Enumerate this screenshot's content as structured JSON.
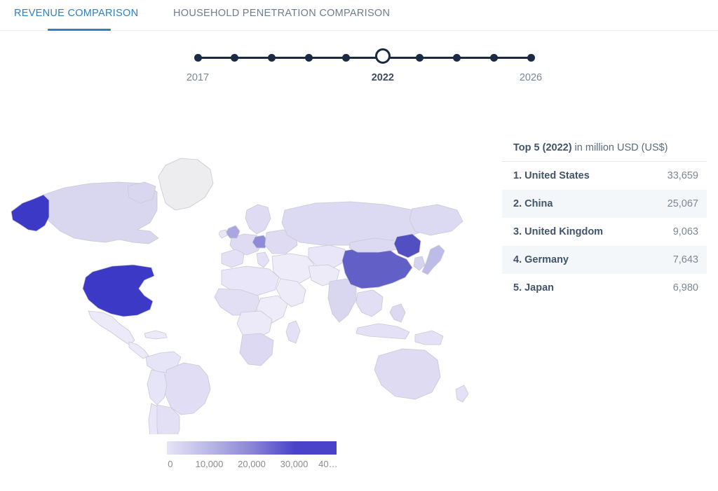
{
  "tabs": [
    {
      "label": "REVENUE COMPARISON",
      "active": true
    },
    {
      "label": "HOUSEHOLD PENETRATION COMPARISON",
      "active": false
    }
  ],
  "colors": {
    "tab_active": "#2f80c4",
    "tab_inactive": "#6e7d8e",
    "slider": "#1b2a44",
    "scale_min": "#f2f1fb",
    "scale_max": "#3333cc"
  },
  "slider": {
    "years": [
      "2017",
      "2018",
      "2019",
      "2020",
      "2021",
      "2022",
      "2023",
      "2024",
      "2025",
      "2026"
    ],
    "selected_year": "2022",
    "selected_index": 5,
    "visible_labels": [
      {
        "text": "2017",
        "index": 0,
        "selected": false
      },
      {
        "text": "2022",
        "index": 5,
        "selected": true
      },
      {
        "text": "2026",
        "index": 9,
        "selected": false
      }
    ]
  },
  "top5": {
    "title_strong": "Top 5 (2022)",
    "title_rest": " in million USD (US$)",
    "rows": [
      {
        "name": "1. United States",
        "value": "33,659"
      },
      {
        "name": "2. China",
        "value": "25,067"
      },
      {
        "name": "3. United Kingdom",
        "value": "9,063"
      },
      {
        "name": "4. Germany",
        "value": "7,643"
      },
      {
        "name": "5. Japan",
        "value": "6,980"
      }
    ]
  },
  "legend": {
    "segments": [
      "#e6e4f7",
      "#b9b6e6",
      "#8a86d6",
      "#4a43c9"
    ],
    "labels": [
      {
        "text": "0",
        "pos": 2
      },
      {
        "text": "10,000",
        "pos": 25
      },
      {
        "text": "20,000",
        "pos": 50
      },
      {
        "text": "30,000",
        "pos": 75
      },
      {
        "text": "40…",
        "pos": 95
      }
    ]
  },
  "chart_data": {
    "type": "heatmap",
    "title": "Revenue Comparison",
    "subtitle": "Top 5 (2022) in million USD (US$)",
    "unit": "million USD (US$)",
    "year": "2022",
    "colorbar": {
      "ticks": [
        0,
        10000,
        20000,
        30000,
        40000
      ],
      "tick_labels": [
        "0",
        "10,000",
        "20,000",
        "30,000",
        "40…"
      ],
      "range": [
        0,
        40000
      ],
      "colors": [
        "#e6e4f7",
        "#b9b6e6",
        "#8a86d6",
        "#4a43c9"
      ]
    },
    "regions": [
      {
        "name": "United States",
        "value": 33659,
        "rank": 1,
        "fill": "#3b39c6"
      },
      {
        "name": "China",
        "value": 25067,
        "rank": 2,
        "fill": "#6260c6"
      },
      {
        "name": "United Kingdom",
        "value": 9063,
        "rank": 3,
        "fill": "#a9a6e0"
      },
      {
        "name": "Germany",
        "value": 7643,
        "rank": 4,
        "fill": "#b0ade2"
      },
      {
        "name": "Japan",
        "value": 6980,
        "rank": 5,
        "fill": "#bdbbe8"
      },
      {
        "name": "Other countries",
        "value": null,
        "rank": null,
        "fill": "#e6e4f7"
      }
    ],
    "legend_position": "bottom-left",
    "grid": false
  }
}
